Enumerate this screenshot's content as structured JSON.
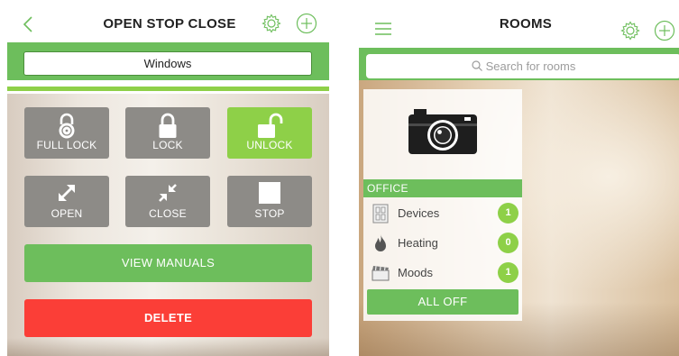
{
  "left": {
    "header": {
      "title": "OPEN STOP CLOSE",
      "back_icon": "chevron-left-icon",
      "settings_icon": "gear-icon",
      "add_icon": "plus-circle-icon"
    },
    "name_field": {
      "value": "Windows"
    },
    "controls": [
      {
        "label": "FULL LOCK",
        "icon": "padlock-icon",
        "active": false
      },
      {
        "label": "LOCK",
        "icon": "lock-icon",
        "active": false
      },
      {
        "label": "UNLOCK",
        "icon": "unlock-icon",
        "active": true
      },
      {
        "label": "OPEN",
        "icon": "expand-arrows-icon",
        "active": false
      },
      {
        "label": "CLOSE",
        "icon": "collapse-arrows-icon",
        "active": false
      },
      {
        "label": "STOP",
        "icon": "stop-square-icon",
        "active": false
      }
    ],
    "view_manuals_label": "VIEW MANUALS",
    "delete_label": "DELETE"
  },
  "right": {
    "header": {
      "title": "ROOMS",
      "menu_icon": "hamburger-menu-icon",
      "settings_icon": "gear-icon",
      "add_icon": "plus-circle-icon"
    },
    "search": {
      "placeholder": "Search for rooms"
    },
    "room_card": {
      "image_icon": "camera-icon",
      "name": "OFFICE",
      "rows": [
        {
          "label": "Devices",
          "icon": "devices-icon",
          "count": "1"
        },
        {
          "label": "Heating",
          "icon": "flame-icon",
          "count": "0"
        },
        {
          "label": "Moods",
          "icon": "clapperboard-icon",
          "count": "1"
        }
      ],
      "all_off_label": "ALL OFF"
    }
  },
  "colors": {
    "green": "#6dbe5c",
    "bright_green": "#8ed048",
    "tile_grey": "#8d8b87",
    "delete_red": "#fb3e37"
  }
}
